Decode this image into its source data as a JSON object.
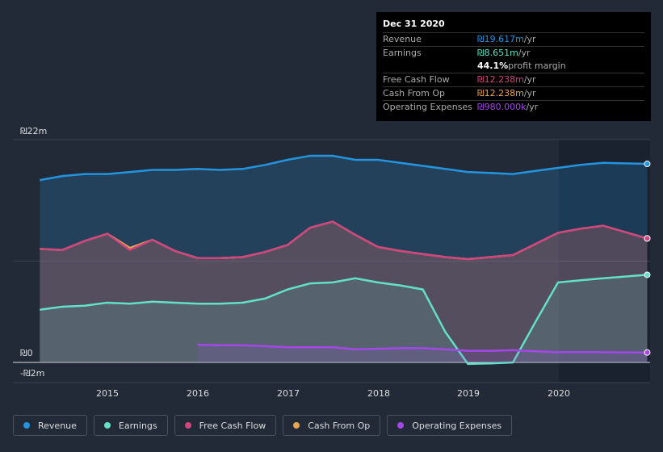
{
  "tooltip": {
    "date": "Dec 31 2020",
    "rows": [
      {
        "label": "Revenue",
        "value": "₪19.617m",
        "unit": " /yr",
        "color": "#2394df"
      },
      {
        "label": "Earnings",
        "value": "₪8.651m",
        "unit": " /yr",
        "color": "#62e0c8"
      },
      {
        "label": "",
        "value": "44.1%",
        "unit": " profit margin",
        "color": "#ffffff"
      },
      {
        "label": "Free Cash Flow",
        "value": "₪12.238m",
        "unit": " /yr",
        "color": "#d0457e"
      },
      {
        "label": "Cash From Op",
        "value": "₪12.238m",
        "unit": " /yr",
        "color": "#e7a552"
      },
      {
        "label": "Operating Expenses",
        "value": "₪980.000k",
        "unit": " /yr",
        "color": "#a447e8"
      }
    ]
  },
  "chart_data": {
    "type": "area",
    "ylim": [
      -2,
      22
    ],
    "y_ticks": [
      {
        "v": 22,
        "label": "₪22m"
      },
      {
        "v": 0,
        "label": "₪0"
      },
      {
        "v": -2,
        "label": "-₪2m"
      }
    ],
    "x_ticks": [
      "2015",
      "2016",
      "2017",
      "2018",
      "2019",
      "2020"
    ],
    "x": [
      2014.25,
      2014.5,
      2014.75,
      2015,
      2015.25,
      2015.5,
      2015.75,
      2016,
      2016.25,
      2016.5,
      2016.75,
      2017,
      2017.25,
      2017.5,
      2017.75,
      2018,
      2018.25,
      2018.5,
      2018.75,
      2019,
      2019.25,
      2019.5,
      2019.75,
      2020,
      2020.25,
      2020.5,
      2020.99
    ],
    "series": [
      {
        "name": "Revenue",
        "color": "#2394df",
        "values": [
          18.0,
          18.4,
          18.6,
          18.6,
          18.8,
          19.0,
          19.0,
          19.1,
          19.0,
          19.1,
          19.5,
          20.0,
          20.4,
          20.4,
          20.0,
          20.0,
          19.7,
          19.4,
          19.1,
          18.8,
          18.7,
          18.6,
          18.9,
          19.2,
          19.5,
          19.7,
          19.6
        ]
      },
      {
        "name": "Earnings",
        "color": "#62e0c8",
        "values": [
          5.2,
          5.5,
          5.6,
          5.9,
          5.8,
          6.0,
          5.9,
          5.8,
          5.8,
          5.9,
          6.3,
          7.2,
          7.8,
          7.9,
          8.3,
          7.9,
          7.6,
          7.2,
          3.0,
          -0.15,
          -0.1,
          0.0,
          4.0,
          7.9,
          8.1,
          8.3,
          8.65
        ]
      },
      {
        "name": "Free Cash Flow",
        "color": "#d0457e",
        "values": [
          11.2,
          11.1,
          12.0,
          12.7,
          11.1,
          12.1,
          11.0,
          10.3,
          10.3,
          10.4,
          10.9,
          11.6,
          13.3,
          13.9,
          12.6,
          11.4,
          11.0,
          10.7,
          10.4,
          10.2,
          10.4,
          10.6,
          11.7,
          12.8,
          13.2,
          13.5,
          12.24
        ]
      },
      {
        "name": "Cash From Op",
        "color": "#e7a552",
        "values": [
          11.2,
          11.1,
          12.0,
          12.7,
          11.3,
          12.1,
          11.0,
          10.3,
          10.3,
          10.4,
          10.9,
          11.6,
          13.3,
          13.9,
          12.6,
          11.4,
          11.0,
          10.7,
          10.4,
          10.2,
          10.4,
          10.6,
          11.7,
          12.8,
          13.2,
          13.5,
          12.24
        ]
      },
      {
        "name": "Operating Expenses",
        "color": "#a447e8",
        "values": [
          null,
          null,
          null,
          null,
          null,
          null,
          null,
          1.75,
          1.7,
          1.7,
          1.6,
          1.5,
          1.5,
          1.5,
          1.3,
          1.35,
          1.4,
          1.4,
          1.3,
          1.15,
          1.15,
          1.2,
          1.1,
          1.0,
          1.0,
          1.0,
          0.98
        ]
      }
    ],
    "legend_position": "bottom-left"
  }
}
